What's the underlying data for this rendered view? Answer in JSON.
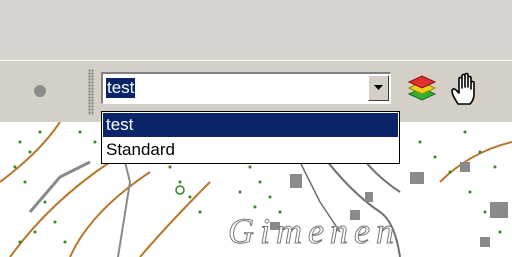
{
  "toolbar": {
    "layer_select": {
      "value": "test",
      "options": [
        "test",
        "Standard"
      ],
      "selected_index": 0,
      "arrow_icon": "chevron-down-icon"
    },
    "icons": [
      "layers-icon",
      "pan-hand-icon"
    ]
  },
  "map": {
    "place_label": "Gimenen",
    "colors": {
      "contour": "#b8762a",
      "vegetation": "#2e8b1f",
      "road": "#707070",
      "building": "#8a8a8a"
    }
  },
  "colors": {
    "toolbar_bg": "#d4d0c8",
    "selection": "#0a246a"
  }
}
